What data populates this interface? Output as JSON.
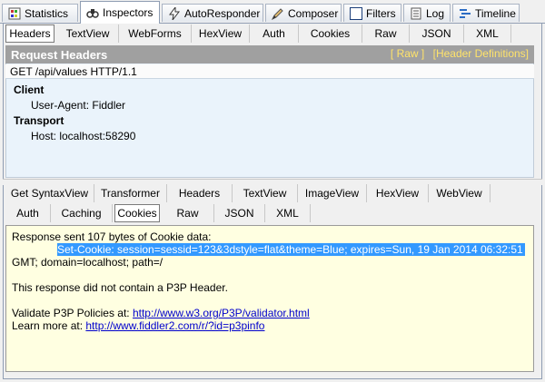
{
  "top_tabs": [
    {
      "label": "Statistics",
      "icon": "statistics-icon"
    },
    {
      "label": "Inspectors",
      "icon": "inspectors-icon"
    },
    {
      "label": "AutoResponder",
      "icon": "autoresponder-icon"
    },
    {
      "label": "Composer",
      "icon": "composer-icon"
    },
    {
      "label": "Filters",
      "icon": "filters-icon"
    },
    {
      "label": "Log",
      "icon": "log-icon"
    },
    {
      "label": "Timeline",
      "icon": "timeline-icon"
    }
  ],
  "request_tabs": [
    "Headers",
    "TextView",
    "WebForms",
    "HexView",
    "Auth",
    "Cookies",
    "Raw",
    "JSON",
    "XML"
  ],
  "request_headers": {
    "title": "Request Headers",
    "raw_link": "[ Raw ]",
    "defs_link": "[Header Definitions]",
    "request_line": "GET /api/values HTTP/1.1",
    "groups": [
      {
        "name": "Client",
        "headers": [
          "User-Agent: Fiddler"
        ]
      },
      {
        "name": "Transport",
        "headers": [
          "Host: localhost:58290"
        ]
      }
    ]
  },
  "response_tabs_row1": [
    "Get SyntaxView",
    "Transformer",
    "Headers",
    "TextView",
    "ImageView",
    "HexView",
    "WebView"
  ],
  "response_tabs_row2": [
    "Auth",
    "Caching",
    "Cookies",
    "Raw",
    "JSON",
    "XML"
  ],
  "response_body": {
    "line1": "Response sent 107 bytes of Cookie data:",
    "selected": "Set-Cookie: session=sessid=123&3dstyle=flat&theme=Blue; expires=Sun, 19 Jan 2014 06:32:51",
    "line3": "GMT; domain=localhost; path=/",
    "line4": "This response did not contain a P3P Header.",
    "validate_prefix": "Validate P3P Policies at: ",
    "validate_link": "http://www.w3.org/P3P/validator.html",
    "learn_prefix": "Learn more at: ",
    "learn_link": "http://www.fiddler2.com/r/?id=p3pinfo"
  }
}
